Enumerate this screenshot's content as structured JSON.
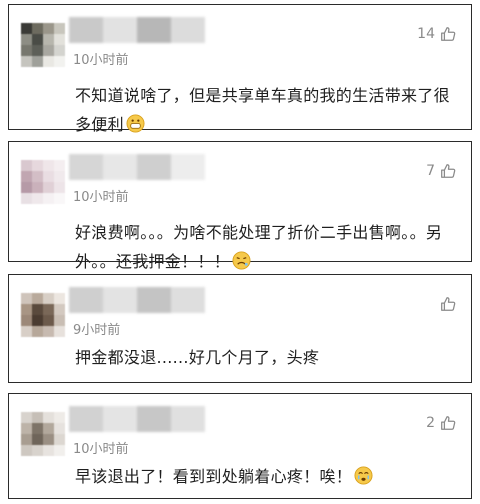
{
  "comments": [
    {
      "time": "10小时前",
      "likes": "14",
      "text": "不知道说啥了，但是共享单车真的我的生活带来了很多便利",
      "emoji": "grinning-face-emoji",
      "avatar_colors": [
        "#3a3a36",
        "#6d6b5f",
        "#9a968a",
        "#c8c6bd",
        "#8d8d84",
        "#4a4c46",
        "#b7b6ad",
        "#e2e1db",
        "#77776e",
        "#5d5f58",
        "#a8a7a0",
        "#d4d4cf",
        "#c5c4be",
        "#9fa09a",
        "#e9e8e3",
        "#f2f2ef"
      ],
      "name_colors": [
        "#c9c9c9",
        "#e2e2e2",
        "#b7b7b7",
        "#dcdcdc"
      ]
    },
    {
      "time": "10小时前",
      "likes": "7",
      "text": "好浪费啊。。。为啥不能处理了折价二手出售啊。。另外。。还我押金！！！",
      "emoji": "weary-face-emoji",
      "avatar_colors": [
        "#d9c8cf",
        "#e6d8dd",
        "#efe6e9",
        "#f4eef0",
        "#c1a6b1",
        "#d3bec6",
        "#e9dde2",
        "#f0e9ec",
        "#b69aa7",
        "#cab1bb",
        "#e0d0d6",
        "#ede4e8",
        "#e8e0e4",
        "#efe8eb",
        "#f5f1f3",
        "#f9f7f8"
      ],
      "name_colors": [
        "#d6d6d6",
        "#e7e7e7",
        "#cfcfcf",
        "#ededed"
      ]
    },
    {
      "time": "9小时前",
      "likes": "",
      "text": "押金都没退......好几个月了，头疼",
      "emoji": "",
      "avatar_colors": [
        "#cfc4bb",
        "#b9aa9c",
        "#d8cfc6",
        "#ece6e0",
        "#a89584",
        "#5a4a3d",
        "#7a6858",
        "#d3c9c0",
        "#9c8878",
        "#4b3c31",
        "#6c5a4b",
        "#c9beb4",
        "#d8cfc7",
        "#b7a89a",
        "#c7bab0",
        "#e7e1dc"
      ],
      "name_colors": [
        "#cfcfcf",
        "#e3e3e3",
        "#c4c4c4",
        "#dedede"
      ]
    },
    {
      "time": "10小时前",
      "likes": "2",
      "text": "早该退出了！看到到处躺着心疼！唉！",
      "emoji": "crying-face-emoji",
      "avatar_colors": [
        "#d8d3cd",
        "#c6bfb7",
        "#e4e0db",
        "#eeebe7",
        "#bdb3a8",
        "#7e7468",
        "#b2a89c",
        "#e6e2de",
        "#a89d91",
        "#6f655a",
        "#9a8f83",
        "#dcd7d1",
        "#cec8c1",
        "#d8d3cd",
        "#e7e3df",
        "#f1efec"
      ],
      "name_colors": [
        "#d2d2d2",
        "#e4e4e4",
        "#c7c7c7",
        "#e0e0e0"
      ]
    }
  ],
  "colors": {
    "time": "#8a8a8a",
    "text": "#1f1f1f",
    "border": "#2b2b2b",
    "emoji_face": "#f6c94a"
  }
}
